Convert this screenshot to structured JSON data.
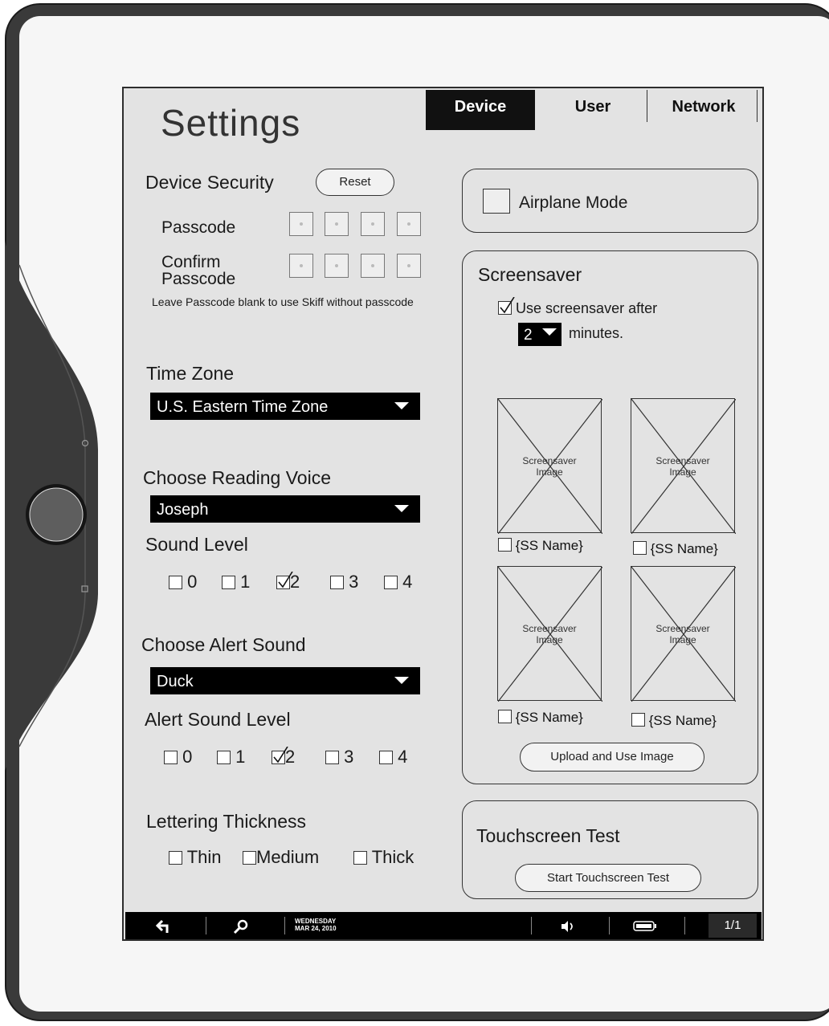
{
  "header": {
    "title": "Settings",
    "tabs": [
      {
        "label": "Device",
        "active": true
      },
      {
        "label": "User",
        "active": false
      },
      {
        "label": "Network",
        "active": false
      }
    ]
  },
  "device_security": {
    "heading": "Device Security",
    "reset_label": "Reset",
    "passcode_label": "Passcode",
    "confirm_label_line1": "Confirm",
    "confirm_label_line2": "Passcode",
    "hint": "Leave Passcode blank to use Skiff without passcode"
  },
  "time_zone": {
    "heading": "Time Zone",
    "selected": "U.S. Eastern Time Zone"
  },
  "reading_voice": {
    "heading": "Choose Reading Voice",
    "selected": "Joseph"
  },
  "sound_level": {
    "heading": "Sound Level",
    "options": [
      "0",
      "1",
      "2",
      "3",
      "4"
    ],
    "checked": "2"
  },
  "alert_sound": {
    "heading": "Choose Alert Sound",
    "selected": "Duck"
  },
  "alert_sound_level": {
    "heading": "Alert Sound Level",
    "options": [
      "0",
      "1",
      "2",
      "3",
      "4"
    ],
    "checked": "2"
  },
  "lettering": {
    "heading": "Lettering Thickness",
    "options": [
      "Thin",
      "Medium",
      "Thick"
    ]
  },
  "airplane_mode": {
    "label": "Airplane Mode",
    "checked": false
  },
  "screensaver": {
    "heading": "Screensaver",
    "use_label": "Use screensaver after",
    "use_checked": true,
    "minutes_value": "2",
    "minutes_label": "minutes.",
    "images": [
      {
        "caption_line1": "Screensaver",
        "caption_line2": "Image",
        "name": "{SS Name}"
      },
      {
        "caption_line1": "Screensaver",
        "caption_line2": "Image",
        "name": "{SS Name}"
      },
      {
        "caption_line1": "Screensaver",
        "caption_line2": "Image",
        "name": "{SS Name}"
      },
      {
        "caption_line1": "Screensaver",
        "caption_line2": "Image",
        "name": "{SS Name}"
      }
    ],
    "upload_label": "Upload and Use Image"
  },
  "touchscreen": {
    "heading": "Touchscreen Test",
    "button_label": "Start Touchscreen Test"
  },
  "statusbar": {
    "back_icon": "back-arrow-icon",
    "search_icon": "search-icon",
    "day": "WEDNESDAY",
    "date": "MAR 24, 2010",
    "volume_icon": "speaker-icon",
    "battery_icon": "battery-icon",
    "page": "1/1"
  }
}
